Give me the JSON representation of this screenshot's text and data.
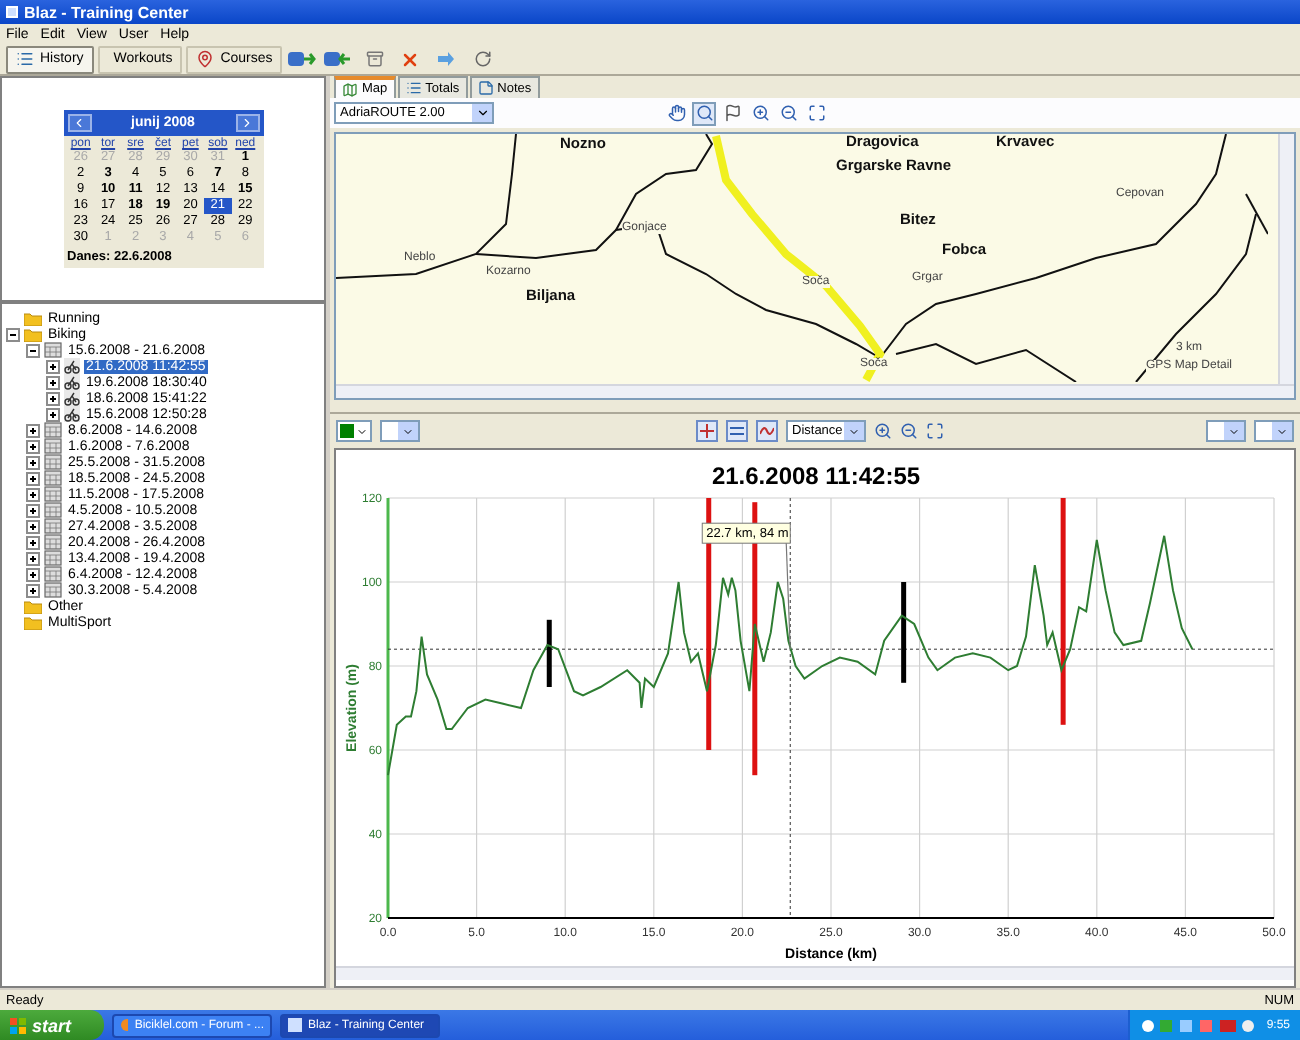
{
  "window": {
    "title": "Blaz - Training Center"
  },
  "menu": [
    "File",
    "Edit",
    "View",
    "User",
    "Help"
  ],
  "toolbar": {
    "views": [
      {
        "label": "History",
        "kind": "history",
        "selected": true
      },
      {
        "label": "Workouts",
        "kind": "workouts",
        "selected": false
      },
      {
        "label": "Courses",
        "kind": "courses",
        "selected": false
      }
    ],
    "actions": [
      {
        "kind": "receive"
      },
      {
        "kind": "send"
      },
      {
        "kind": "archive"
      },
      {
        "kind": "delete"
      },
      {
        "kind": "forward"
      },
      {
        "kind": "refresh"
      }
    ]
  },
  "calendar": {
    "month": "junij 2008",
    "weekdays": [
      "pon",
      "tor",
      "sre",
      "čet",
      "pet",
      "sob",
      "ned"
    ],
    "days": [
      {
        "day": "26",
        "other_month": true,
        "bold": false,
        "selected": false
      },
      {
        "day": "27",
        "other_month": true,
        "bold": false,
        "selected": false
      },
      {
        "day": "28",
        "other_month": true,
        "bold": false,
        "selected": false
      },
      {
        "day": "29",
        "other_month": true,
        "bold": false,
        "selected": false
      },
      {
        "day": "30",
        "other_month": true,
        "bold": false,
        "selected": false
      },
      {
        "day": "31",
        "other_month": true,
        "bold": false,
        "selected": false
      },
      {
        "day": "1",
        "other_month": false,
        "bold": true,
        "selected": false
      },
      {
        "day": "2",
        "other_month": false,
        "bold": false,
        "selected": false
      },
      {
        "day": "3",
        "other_month": false,
        "bold": true,
        "selected": false
      },
      {
        "day": "4",
        "other_month": false,
        "bold": false,
        "selected": false
      },
      {
        "day": "5",
        "other_month": false,
        "bold": false,
        "selected": false
      },
      {
        "day": "6",
        "other_month": false,
        "bold": false,
        "selected": false
      },
      {
        "day": "7",
        "other_month": false,
        "bold": true,
        "selected": false
      },
      {
        "day": "8",
        "other_month": false,
        "bold": false,
        "selected": false
      },
      {
        "day": "9",
        "other_month": false,
        "bold": false,
        "selected": false
      },
      {
        "day": "10",
        "other_month": false,
        "bold": true,
        "selected": false
      },
      {
        "day": "11",
        "other_month": false,
        "bold": true,
        "selected": false
      },
      {
        "day": "12",
        "other_month": false,
        "bold": false,
        "selected": false
      },
      {
        "day": "13",
        "other_month": false,
        "bold": false,
        "selected": false
      },
      {
        "day": "14",
        "other_month": false,
        "bold": false,
        "selected": false
      },
      {
        "day": "15",
        "other_month": false,
        "bold": true,
        "selected": false
      },
      {
        "day": "16",
        "other_month": false,
        "bold": false,
        "selected": false
      },
      {
        "day": "17",
        "other_month": false,
        "bold": false,
        "selected": false
      },
      {
        "day": "18",
        "other_month": false,
        "bold": true,
        "selected": false
      },
      {
        "day": "19",
        "other_month": false,
        "bold": true,
        "selected": false
      },
      {
        "day": "20",
        "other_month": false,
        "bold": false,
        "selected": false
      },
      {
        "day": "21",
        "other_month": false,
        "bold": false,
        "selected": true
      },
      {
        "day": "22",
        "other_month": false,
        "bold": false,
        "selected": false
      },
      {
        "day": "23",
        "other_month": false,
        "bold": false,
        "selected": false
      },
      {
        "day": "24",
        "other_month": false,
        "bold": false,
        "selected": false
      },
      {
        "day": "25",
        "other_month": false,
        "bold": false,
        "selected": false
      },
      {
        "day": "26",
        "other_month": false,
        "bold": false,
        "selected": false
      },
      {
        "day": "27",
        "other_month": false,
        "bold": false,
        "selected": false
      },
      {
        "day": "28",
        "other_month": false,
        "bold": false,
        "selected": false
      },
      {
        "day": "29",
        "other_month": false,
        "bold": false,
        "selected": false
      },
      {
        "day": "30",
        "other_month": false,
        "bold": false,
        "selected": false
      },
      {
        "day": "1",
        "other_month": true,
        "bold": false,
        "selected": false
      },
      {
        "day": "2",
        "other_month": true,
        "bold": false,
        "selected": false
      },
      {
        "day": "3",
        "other_month": true,
        "bold": false,
        "selected": false
      },
      {
        "day": "4",
        "other_month": true,
        "bold": false,
        "selected": false
      },
      {
        "day": "5",
        "other_month": true,
        "bold": false,
        "selected": false
      },
      {
        "day": "6",
        "other_month": true,
        "bold": false,
        "selected": false
      }
    ],
    "today": "Danes: 22.6.2008"
  },
  "tree": [
    {
      "label": "Running",
      "kind": "folder",
      "selected": false
    },
    {
      "label": "Biking",
      "kind": "folder",
      "selected": false,
      "expanded": true,
      "children": [
        {
          "label": "15.6.2008 - 21.6.2008",
          "kind": "week",
          "selected": false,
          "expanded": true,
          "children": [
            {
              "label": "21.6.2008 11:42:55",
              "kind": "activity",
              "selected": true,
              "expanded": false
            },
            {
              "label": "19.6.2008 18:30:40",
              "kind": "activity",
              "selected": false,
              "expanded": false
            },
            {
              "label": "18.6.2008 15:41:22",
              "kind": "activity",
              "selected": false,
              "expanded": false
            },
            {
              "label": "15.6.2008 12:50:28",
              "kind": "activity",
              "selected": false,
              "expanded": false
            }
          ]
        },
        {
          "label": "8.6.2008 - 14.6.2008",
          "kind": "week",
          "selected": false,
          "expanded": false
        },
        {
          "label": "1.6.2008 - 7.6.2008",
          "kind": "week",
          "selected": false,
          "expanded": false
        },
        {
          "label": "25.5.2008 - 31.5.2008",
          "kind": "week",
          "selected": false,
          "expanded": false
        },
        {
          "label": "18.5.2008 - 24.5.2008",
          "kind": "week",
          "selected": false,
          "expanded": false
        },
        {
          "label": "11.5.2008 - 17.5.2008",
          "kind": "week",
          "selected": false,
          "expanded": false
        },
        {
          "label": "4.5.2008 - 10.5.2008",
          "kind": "week",
          "selected": false,
          "expanded": false
        },
        {
          "label": "27.4.2008 - 3.5.2008",
          "kind": "week",
          "selected": false,
          "expanded": false
        },
        {
          "label": "20.4.2008 - 26.4.2008",
          "kind": "week",
          "selected": false,
          "expanded": false
        },
        {
          "label": "13.4.2008 - 19.4.2008",
          "kind": "week",
          "selected": false,
          "expanded": false
        },
        {
          "label": "6.4.2008 - 12.4.2008",
          "kind": "week",
          "selected": false,
          "expanded": false
        },
        {
          "label": "30.3.2008 - 5.4.2008",
          "kind": "week",
          "selected": false,
          "expanded": false
        }
      ]
    },
    {
      "label": "Other",
      "kind": "folder",
      "selected": false
    },
    {
      "label": "MultiSport",
      "kind": "folder",
      "selected": false
    }
  ],
  "detail_tabs": [
    {
      "label": "Map",
      "kind": "map",
      "selected": true
    },
    {
      "label": "Totals",
      "kind": "totals",
      "selected": false
    },
    {
      "label": "Notes",
      "kind": "notes",
      "selected": false
    }
  ],
  "map": {
    "source": "AdriaROUTE 2.00",
    "tools": [
      {
        "kind": "pan",
        "selected": false
      },
      {
        "kind": "select",
        "selected": true
      },
      {
        "kind": "flag",
        "selected": false
      },
      {
        "kind": "zoom_in",
        "selected": false
      },
      {
        "kind": "zoom_out",
        "selected": false
      },
      {
        "kind": "fit",
        "selected": false
      }
    ],
    "labels": [
      {
        "text": "Nozno",
        "bold": true
      },
      {
        "text": "Dragovica",
        "bold": true
      },
      {
        "text": "Krvavec",
        "bold": true
      },
      {
        "text": "Grgarske Ravne",
        "bold": true
      },
      {
        "text": "Cepovan",
        "bold": false
      },
      {
        "text": "Bitez",
        "bold": true
      },
      {
        "text": "Fobca",
        "bold": true
      },
      {
        "text": "Gonjace",
        "bold": false
      },
      {
        "text": "Neblo",
        "bold": false
      },
      {
        "text": "Kozarno",
        "bold": false
      },
      {
        "text": "Biljana",
        "bold": true
      },
      {
        "text": "Soča",
        "bold": false
      },
      {
        "text": "Grgar",
        "bold": false
      },
      {
        "text": "Soča",
        "bold": false
      }
    ],
    "scale": "3 km",
    "credit": "GPS Map Detail"
  },
  "chart_toolbar": {
    "series_picker": {
      "color": "#008000"
    },
    "x_axis": "Distance"
  },
  "lap_markers": [
    {
      "color": "#000000"
    },
    {
      "color": "#dd1111"
    },
    {
      "color": "#dd1111"
    },
    {
      "color": "#000000"
    },
    {
      "color": "#dd1111"
    }
  ],
  "chart_data": {
    "type": "line",
    "title": "21.6.2008 11:42:55",
    "xlabel": "Distance (km)",
    "ylabel": "Elevation (m)",
    "x": [
      0,
      0.5,
      1,
      1.3,
      1.6,
      1.9,
      2.2,
      2.8,
      3.3,
      3.6,
      4.5,
      5.5,
      6.5,
      7.5,
      8.2,
      9,
      9.6,
      10.5,
      11,
      12,
      13.5,
      14.2,
      14.3,
      14.5,
      15,
      15.8,
      16.4,
      16.7,
      17.1,
      17.5,
      18,
      18.5,
      18.9,
      19.2,
      19.4,
      19.6,
      19.9,
      20.4,
      20.7,
      21.2,
      21.6,
      22,
      22.3,
      22.6,
      23,
      23.5,
      24.5,
      25.5,
      26.5,
      27.5,
      28,
      29,
      29.7,
      30.5,
      31,
      32,
      33,
      34,
      35,
      35.5,
      36,
      36.5,
      37,
      37.2,
      37.5,
      38,
      38.5,
      39,
      39.4,
      40,
      40.5,
      41,
      41.5,
      42.5,
      43,
      43.8,
      44.3,
      44.8,
      45.4
    ],
    "grid": true,
    "series": [
      {
        "color": "#2e7d32",
        "values": [
          54,
          66,
          68,
          68,
          74,
          87,
          78,
          72,
          65,
          65,
          70,
          72,
          71,
          70,
          79,
          85,
          84,
          74,
          73,
          75,
          79,
          76,
          70,
          77,
          75,
          83,
          100,
          88,
          81,
          83,
          74,
          85,
          101,
          97,
          101,
          98,
          86,
          74,
          90,
          81,
          88,
          100,
          96,
          86,
          80,
          77,
          80,
          82,
          81,
          78,
          86,
          92,
          90,
          82,
          79,
          82,
          83,
          82,
          79,
          80,
          87,
          104,
          92,
          85,
          88,
          79,
          84,
          94,
          93,
          110,
          98,
          88,
          85,
          86,
          95,
          111,
          98,
          89,
          84
        ]
      }
    ],
    "xlim": [
      0,
      50
    ],
    "ylim": [
      20,
      120
    ],
    "xticks": [
      {
        "value": 0,
        "label": "0.0"
      },
      {
        "value": 5,
        "label": "5.0"
      },
      {
        "value": 10,
        "label": "10.0"
      },
      {
        "value": 15,
        "label": "15.0"
      },
      {
        "value": 20,
        "label": "20.0"
      },
      {
        "value": 25,
        "label": "25.0"
      },
      {
        "value": 30,
        "label": "30.0"
      },
      {
        "value": 35,
        "label": "35.0"
      },
      {
        "value": 40,
        "label": "40.0"
      },
      {
        "value": 45,
        "label": "45.0"
      },
      {
        "value": 50,
        "label": "50.0"
      }
    ],
    "yticks": [
      20,
      40,
      60,
      80,
      100,
      120
    ],
    "ref_lines": [
      {
        "axis": "x",
        "value": 22.7
      },
      {
        "axis": "y",
        "value": 84
      }
    ],
    "annotations": [
      {
        "x": 22.7,
        "y": 84,
        "text": "22.7 km, 84 m"
      }
    ]
  },
  "status_bar": {
    "text": "Ready",
    "indicator": "NUM"
  },
  "taskbar": {
    "start": "start",
    "tasks": [
      {
        "label": "Biciklel.com - Forum - ...",
        "kind": "browser",
        "selected": false
      },
      {
        "label": "Blaz - Training Center",
        "kind": "app",
        "selected": true
      }
    ],
    "clock": "9:55"
  }
}
